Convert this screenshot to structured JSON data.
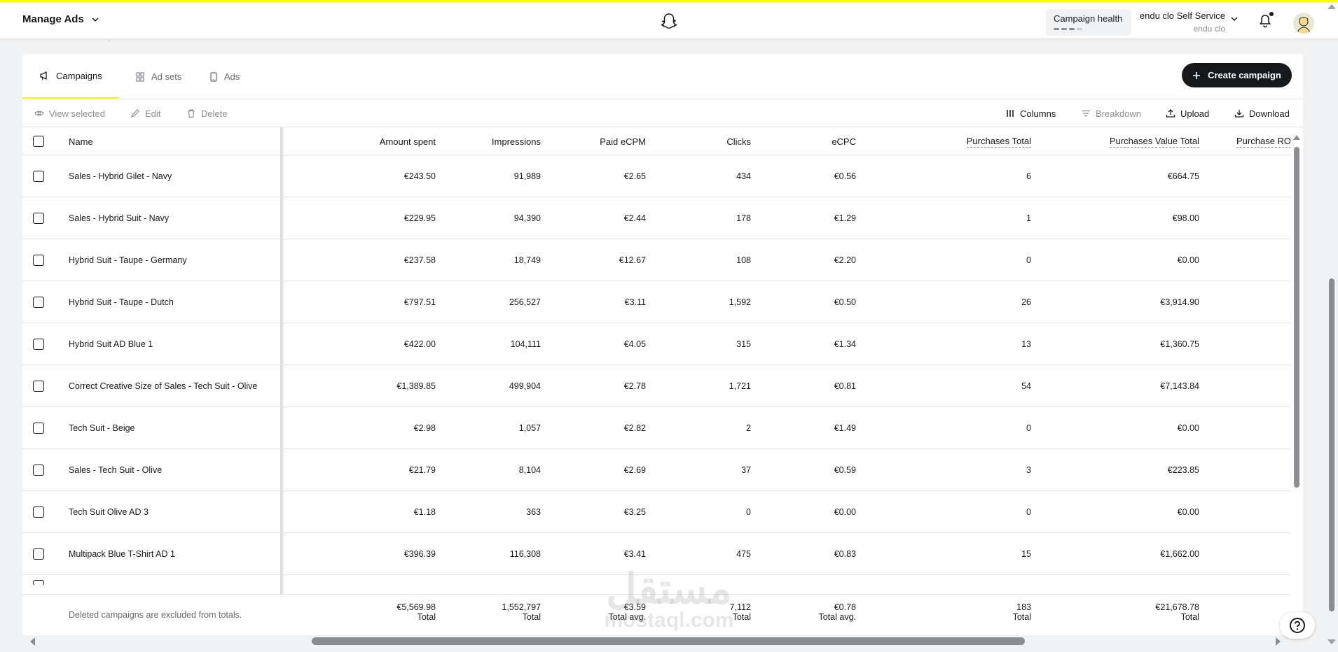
{
  "header": {
    "title": "Manage Ads",
    "health_label": "Campaign health",
    "account_name": "endu clo Self Service",
    "account_sub": "endu clo"
  },
  "tabs": [
    {
      "label": "Campaigns",
      "icon": "megaphone-icon",
      "active": true
    },
    {
      "label": "Ad sets",
      "icon": "grid-icon",
      "active": false
    },
    {
      "label": "Ads",
      "icon": "phone-icon",
      "active": false
    }
  ],
  "create_button": "Create campaign",
  "toolbar": {
    "view_selected": "View selected",
    "edit": "Edit",
    "delete": "Delete",
    "columns": "Columns",
    "breakdown": "Breakdown",
    "upload": "Upload",
    "download": "Download"
  },
  "columns": [
    "Name",
    "Amount spent",
    "Impressions",
    "Paid eCPM",
    "Clicks",
    "eCPC",
    "Purchases Total",
    "Purchases Value Total",
    "Purchase RO"
  ],
  "rows": [
    {
      "name": "Sales - Hybrid Gilet - Navy",
      "spent": "€243.50",
      "impr": "91,989",
      "ecpm": "€2.65",
      "clicks": "434",
      "ecpc": "€0.56",
      "purch": "6",
      "value": "€664.75"
    },
    {
      "name": "Sales - Hybrid Suit - Navy",
      "spent": "€229.95",
      "impr": "94,390",
      "ecpm": "€2.44",
      "clicks": "178",
      "ecpc": "€1.29",
      "purch": "1",
      "value": "€98.00"
    },
    {
      "name": "Hybrid Suit - Taupe - Germany",
      "spent": "€237.58",
      "impr": "18,749",
      "ecpm": "€12.67",
      "clicks": "108",
      "ecpc": "€2.20",
      "purch": "0",
      "value": "€0.00"
    },
    {
      "name": "Hybrid Suit - Taupe - Dutch",
      "spent": "€797.51",
      "impr": "256,527",
      "ecpm": "€3.11",
      "clicks": "1,592",
      "ecpc": "€0.50",
      "purch": "26",
      "value": "€3,914.90"
    },
    {
      "name": "Hybrid Suit AD Blue 1",
      "spent": "€422.00",
      "impr": "104,111",
      "ecpm": "€4.05",
      "clicks": "315",
      "ecpc": "€1.34",
      "purch": "13",
      "value": "€1,360.75"
    },
    {
      "name": "Correct Creative Size of Sales - Tech Suit - Olive",
      "spent": "€1,389.85",
      "impr": "499,904",
      "ecpm": "€2.78",
      "clicks": "1,721",
      "ecpc": "€0.81",
      "purch": "54",
      "value": "€7,143.84"
    },
    {
      "name": "Tech Suit - Beige",
      "spent": "€2.98",
      "impr": "1,057",
      "ecpm": "€2.82",
      "clicks": "2",
      "ecpc": "€1.49",
      "purch": "0",
      "value": "€0.00"
    },
    {
      "name": "Sales - Tech Suit - Olive",
      "spent": "€21.79",
      "impr": "8,104",
      "ecpm": "€2.69",
      "clicks": "37",
      "ecpc": "€0.59",
      "purch": "3",
      "value": "€223.85"
    },
    {
      "name": "Tech Suit Olive AD 3",
      "spent": "€1.18",
      "impr": "363",
      "ecpm": "€3.25",
      "clicks": "0",
      "ecpc": "€0.00",
      "purch": "0",
      "value": "€0.00"
    },
    {
      "name": "Multipack Blue T-Shirt AD 1",
      "spent": "€396.39",
      "impr": "116,308",
      "ecpm": "€3.41",
      "clicks": "475",
      "ecpc": "€0.83",
      "purch": "15",
      "value": "€1,662.00"
    }
  ],
  "totals": {
    "note": "Deleted campaigns are excluded from totals.",
    "spent": "€5,569.98",
    "spent_lbl": "Total",
    "impr": "1,552,797",
    "impr_lbl": "Total",
    "ecpm": "€3.59",
    "ecpm_lbl": "Total avg.",
    "clicks": "7,112",
    "clicks_lbl": "Total",
    "ecpc": "€0.78",
    "ecpc_lbl": "Total avg.",
    "purch": "183",
    "purch_lbl": "Total",
    "value": "€21,678.78",
    "value_lbl": "Total"
  },
  "watermark": {
    "line1": "مستقل",
    "line2": "mostaql.com"
  }
}
